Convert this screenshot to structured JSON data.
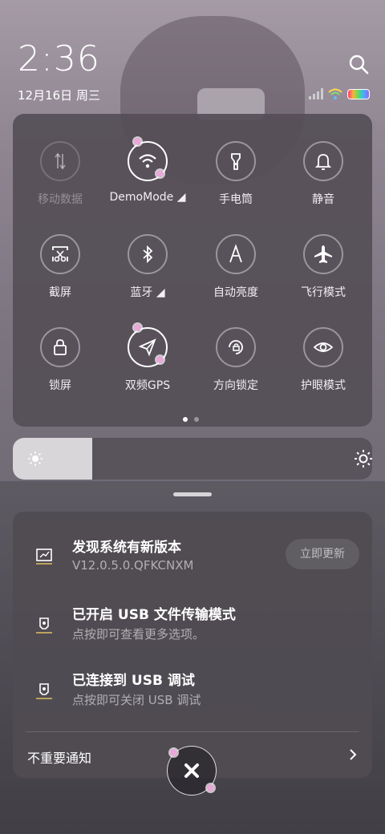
{
  "status": {
    "time": "2:36",
    "date": "12月16日 周三"
  },
  "icons": {
    "search": "search-icon",
    "signal": "signal-icon",
    "wifi": "wifi-icon",
    "battery": "battery-icon"
  },
  "quick_tiles": [
    {
      "label": "移动数据",
      "icon": "mobile-data-icon",
      "state": "disabled"
    },
    {
      "label": "DemoMode ◢",
      "icon": "wifi-icon",
      "state": "on"
    },
    {
      "label": "手电筒",
      "icon": "flashlight-icon",
      "state": "off"
    },
    {
      "label": "静音",
      "icon": "bell-icon",
      "state": "off"
    },
    {
      "label": "截屏",
      "icon": "screenshot-icon",
      "state": "off"
    },
    {
      "label": "蓝牙 ◢",
      "icon": "bluetooth-icon",
      "state": "off"
    },
    {
      "label": "自动亮度",
      "icon": "auto-brightness-icon",
      "state": "off"
    },
    {
      "label": "飞行模式",
      "icon": "airplane-icon",
      "state": "off"
    },
    {
      "label": "锁屏",
      "icon": "lock-icon",
      "state": "off"
    },
    {
      "label": "双频GPS",
      "icon": "gps-icon",
      "state": "on"
    },
    {
      "label": "方向锁定",
      "icon": "rotation-lock-icon",
      "state": "off"
    },
    {
      "label": "护眼模式",
      "icon": "eye-icon",
      "state": "off"
    }
  ],
  "pager": {
    "pages": 2,
    "current": 1
  },
  "brightness": {
    "level_percent": 22
  },
  "notifications": [
    {
      "title": "发现系统有新版本",
      "subtitle": "V12.0.5.0.QFKCNXM",
      "action": "立即更新"
    },
    {
      "title": "已开启 USB 文件传输模式",
      "subtitle": "点按即可查看更多选项。"
    },
    {
      "title": "已连接到 USB 调试",
      "subtitle": "点按即可关闭 USB 调试"
    }
  ],
  "minor_notifications_label": "不重要通知",
  "colors": {
    "panel": "#554f57",
    "brightness_fill": "#d9d6da",
    "accent_flower": "#e8a8d8"
  }
}
